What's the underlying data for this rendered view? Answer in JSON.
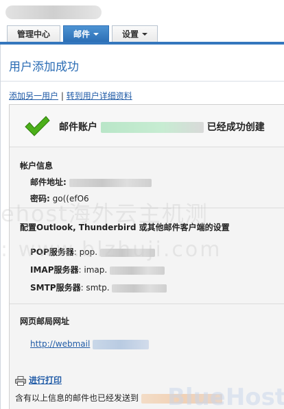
{
  "tabs": [
    {
      "label": "管理中心",
      "active": false,
      "dropdown": false
    },
    {
      "label": "邮件",
      "active": true,
      "dropdown": true
    },
    {
      "label": "设置",
      "active": false,
      "dropdown": true
    }
  ],
  "page": {
    "title": "用户添加成功"
  },
  "actions": {
    "add_another": "添加另一用户",
    "separator": "|",
    "go_details": "转到用户详细资料"
  },
  "success": {
    "prefix": "邮件账户",
    "suffix": "已经成功创建"
  },
  "account": {
    "section_title": "帐户信息",
    "email_label": "邮件地址:",
    "password_label": "密码:",
    "password_value": "go((efO6"
  },
  "client_settings": {
    "section_title": "配置Outlook, Thunderbird 或其他邮件客户端的设置",
    "pop_label": "POP服务器",
    "pop_value": ": pop.",
    "imap_label": "IMAP服务器",
    "imap_value": ": imap.",
    "smtp_label": "SMTP服务器",
    "smtp_value": ": smtp."
  },
  "webmail": {
    "section_title": "网页邮局网址",
    "url": "http://webmail"
  },
  "print": {
    "label": "进行打印"
  },
  "note": {
    "text": "含有以上信息的邮件也已经发送到"
  },
  "watermark": {
    "line1": "ehost海外云主机测",
    "line2": ": www.blzhuji.com",
    "logo": "BlueHost"
  },
  "colors": {
    "accent": "#2c6fb6",
    "link": "#1f5aa6",
    "check": "#4caf1a"
  }
}
